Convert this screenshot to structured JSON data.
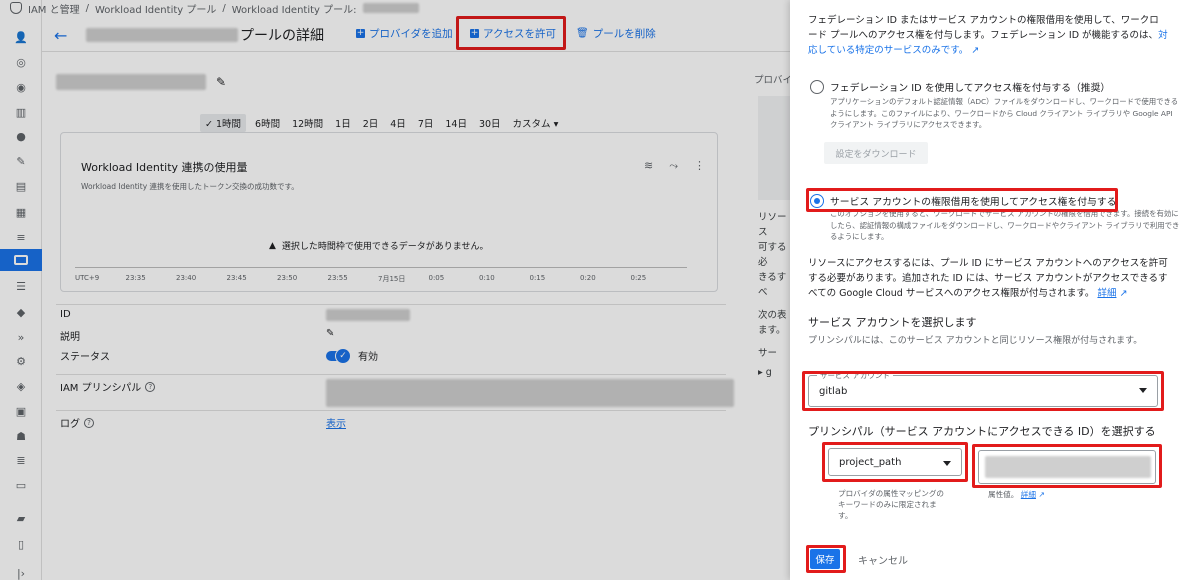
{
  "breadcrumb": {
    "items": [
      "IAM と管理",
      "Workload Identity プール",
      "Workload Identity プール:"
    ],
    "separator": "/"
  },
  "header": {
    "title": "プールの詳細",
    "add_provider": "プロバイダを追加",
    "grant_access": "アクセスを許可",
    "delete_pool": "プールを削除"
  },
  "timerange": {
    "options": [
      "1時間",
      "6時間",
      "12時間",
      "1日",
      "2日",
      "4日",
      "7日",
      "14日",
      "30日",
      "カスタム"
    ],
    "selected": "1時間"
  },
  "chart": {
    "title": "Workload Identity 連携の使用量",
    "subtitle": "Workload Identity 連携を使用したトークン交換の成功数です。",
    "no_data": "選択した時間枠で使用できるデータがありません。",
    "x_ticks": [
      "UTC+9",
      "23:35",
      "23:40",
      "23:45",
      "23:50",
      "23:55",
      "7月15日",
      "0:05",
      "0:10",
      "0:15",
      "0:20",
      "0:25"
    ]
  },
  "chart_data": {
    "type": "line",
    "title": "Workload Identity 連携の使用量",
    "subtitle": "Workload Identity 連携を使用したトークン交換の成功数です。",
    "x": [
      "23:35",
      "23:40",
      "23:45",
      "23:50",
      "23:55",
      "7月15日",
      "0:05",
      "0:10",
      "0:15",
      "0:20",
      "0:25"
    ],
    "series": [],
    "xlabel": "UTC+9",
    "ylabel": "",
    "annotation": "選択した時間枠で使用できるデータがありません。"
  },
  "properties": {
    "id_label": "ID",
    "description_label": "説明",
    "status_label": "ステータス",
    "status_value": "有効",
    "principal_label": "IAM プリンシパル",
    "log_label": "ログ",
    "log_value": "表示"
  },
  "background_right": {
    "tab_label": "プロバイ",
    "line1": "リソース",
    "line2": "可する必",
    "line3": "きるすべ",
    "line4": "次の表",
    "line5": "ます。",
    "row_label": "サー",
    "row_label2": "g"
  },
  "panel": {
    "intro": "フェデレーション ID またはサービス アカウントの権限借用を使用して、ワークロード プールへのアクセス権を付与します。フェデレーション ID が機能するのは、",
    "intro_link": "対応している特定のサービスのみです。",
    "option1_title": "フェデレーション ID を使用してアクセス権を付与する（推奨）",
    "option1_desc": "アプリケーションのデフォルト認証情報（ADC）ファイルをダウンロードし、ワークロードで使用できるようにします。このファイルにより、ワークロードから Cloud クライアント ライブラリや Google API クライアント ライブラリにアクセスできます。",
    "download_button": "設定をダウンロード",
    "option2_title": "サービス アカウントの権限借用を使用してアクセス権を付与する",
    "option2_desc": "このオプションを使用すると、ワークロードでサービス アカウントの権限を借用できます。接続を有効にしたら、認証情報の構成ファイルをダウンロードし、ワークロードやクライアント ライブラリで利用できるようにします。",
    "access_para": "リソースにアクセスするには、プール ID にサービス アカウントへのアクセスを許可する必要があります。追加された ID には、サービス アカウントがアクセスできるすべての Google Cloud サービスへのアクセス権限が付与されます。",
    "access_link": "詳細",
    "sa_heading": "サービス アカウントを選択します",
    "sa_help": "プリンシパルには、このサービス アカウントと同じリソース権限が付与されます。",
    "sa_field_label": "サービス アカウント",
    "sa_field_value": "gitlab",
    "principal_heading": "プリンシパル（サービス アカウントにアクセスできる ID）を選択する",
    "attr_select_value": "project_path",
    "attr_help": "プロバイダの属性マッピングのキーワードのみに限定されます。",
    "attr_value_help": "属性値。",
    "attr_value_link": "詳細",
    "save_button": "保存",
    "cancel_button": "キャンセル"
  },
  "colors": {
    "accent": "#1a73e8",
    "highlight": "#e21b1b"
  }
}
